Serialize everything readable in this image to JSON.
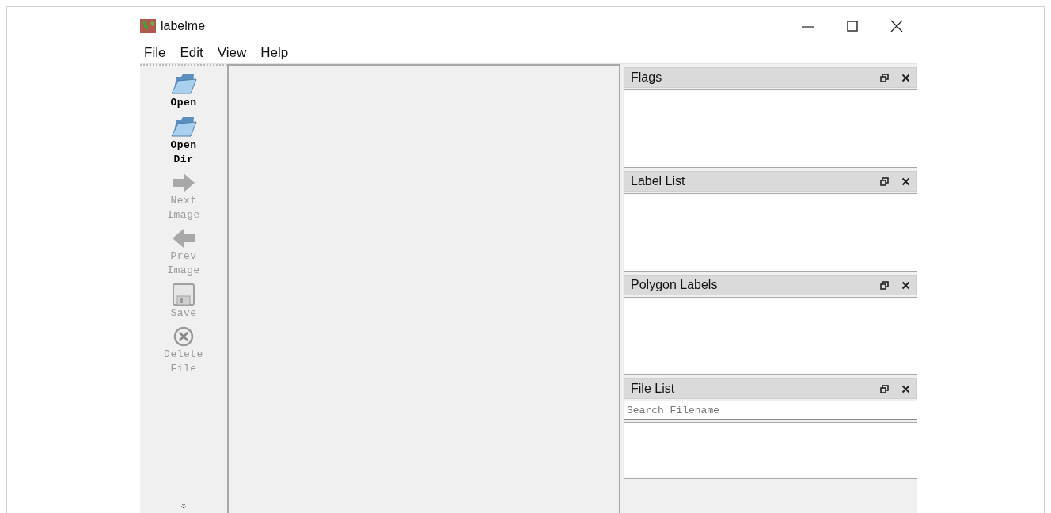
{
  "window": {
    "title": "labelme"
  },
  "menu": [
    "File",
    "Edit",
    "View",
    "Help"
  ],
  "toolbar": [
    {
      "kind": "folder",
      "label": "Open",
      "disabled": false
    },
    {
      "kind": "folder",
      "label": "Open Dir",
      "disabled": false
    },
    {
      "kind": "next",
      "label": "Next Image",
      "disabled": true
    },
    {
      "kind": "prev",
      "label": "Prev Image",
      "disabled": true
    },
    {
      "kind": "save",
      "label": "Save",
      "disabled": true
    },
    {
      "kind": "delete",
      "label": "Delete File",
      "disabled": true
    }
  ],
  "docks": [
    {
      "title": "Flags"
    },
    {
      "title": "Label List"
    },
    {
      "title": "Polygon Labels"
    },
    {
      "title": "File List",
      "search": {
        "placeholder": "Search Filename"
      }
    }
  ]
}
